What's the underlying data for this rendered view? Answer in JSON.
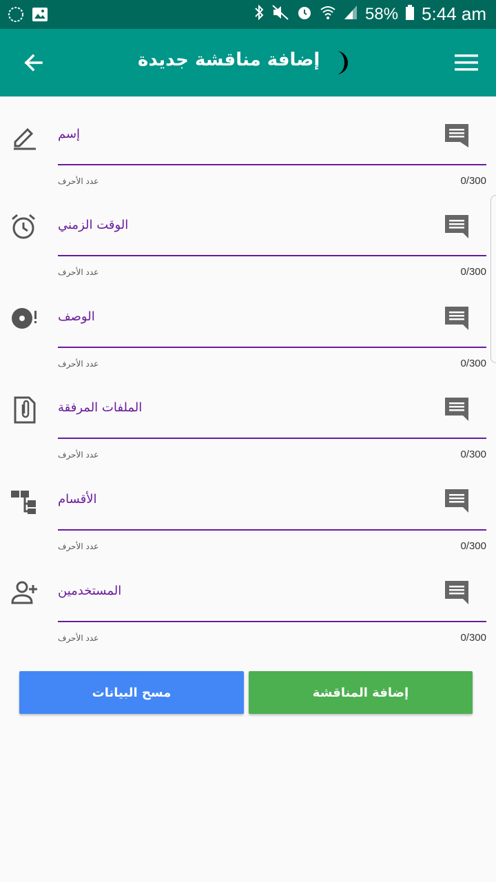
{
  "status_bar": {
    "battery": "58%",
    "time": "5:44 am"
  },
  "app_bar": {
    "title": "إضافة مناقشة جديدة",
    "back_icon": "arrow-back-icon",
    "menu_icon": "hamburger-menu-icon",
    "moon_icon": "crescent-moon-icon"
  },
  "fields": [
    {
      "label": "إسم",
      "helper": "عدد الأحرف",
      "counter": "0/300",
      "icon": "pencil-icon"
    },
    {
      "label": "الوقت الزمني",
      "helper": "عدد الأحرف",
      "counter": "0/300",
      "icon": "alarm-clock-icon"
    },
    {
      "label": "الوصف",
      "helper": "عدد الأحرف",
      "counter": "0/300",
      "icon": "disc-alert-icon"
    },
    {
      "label": "الملفات المرفقة",
      "helper": "عدد الأحرف",
      "counter": "0/300",
      "icon": "attachment-icon"
    },
    {
      "label": "الأقسام",
      "helper": "عدد الأحرف",
      "counter": "0/300",
      "icon": "sitemap-icon"
    },
    {
      "label": "المستخدمين",
      "helper": "عدد الأحرف",
      "counter": "0/300",
      "icon": "add-user-icon"
    }
  ],
  "buttons": {
    "clear": "مسح البيانات",
    "add": "إضافة المناقشة"
  },
  "colors": {
    "status_bar": "#00695c",
    "app_bar": "#009688",
    "accent": "#6a1b9a",
    "clear_button": "#4287f5",
    "add_button": "#4caf50"
  }
}
